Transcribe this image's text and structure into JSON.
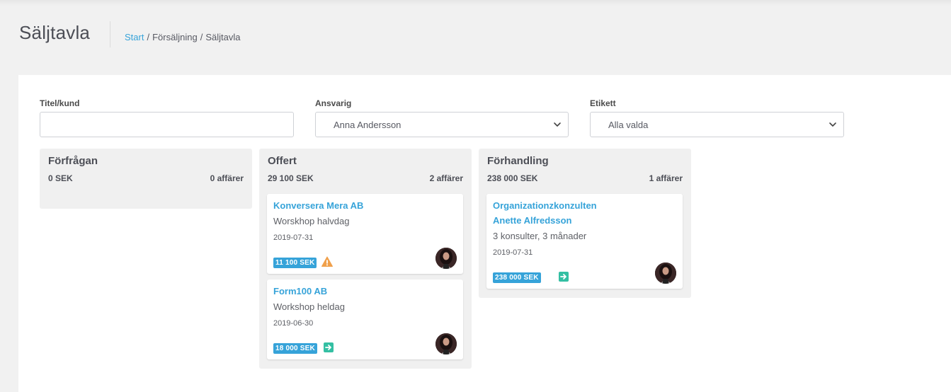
{
  "header": {
    "title": "Säljtavla",
    "breadcrumb": {
      "start": "Start",
      "sep1": "/",
      "sales": "Försäljning",
      "sep2": "/",
      "current": "Säljtavla"
    }
  },
  "filters": {
    "title_customer": {
      "label": "Titel/kund",
      "value": ""
    },
    "responsible": {
      "label": "Ansvarig",
      "value": "Anna Andersson"
    },
    "tag": {
      "label": "Etikett",
      "value": "Alla valda"
    }
  },
  "columns": [
    {
      "title": "Förfrågan",
      "sum": "0 SEK",
      "count": "0 affärer",
      "cards": []
    },
    {
      "title": "Offert",
      "sum": "29 100 SEK",
      "count": "2 affärer",
      "cards": [
        {
          "title": "Konversera Mera AB",
          "description": "Worskhop halvdag",
          "date": "2019-07-31",
          "amount": "11 100 SEK",
          "status_icon": "warning-icon"
        },
        {
          "title": "Form100 AB",
          "description": "Workshop heldag",
          "date": "2019-06-30",
          "amount": "18 000 SEK",
          "status_icon": "arrow-right-icon"
        }
      ]
    },
    {
      "title": "Förhandling",
      "sum": "238 000 SEK",
      "count": "1 affärer",
      "cards": [
        {
          "title_line1": "Organizationzkonzulten",
          "title_line2": "Anette Alfredsson",
          "description": "3 konsulter, 3 månader",
          "date": "2019-07-31",
          "amount": "238 000 SEK",
          "status_icon": "arrow-right-icon"
        }
      ]
    }
  ],
  "colors": {
    "accent": "#36a3d9",
    "warning": "#f0a04b",
    "success": "#34bfa3"
  }
}
